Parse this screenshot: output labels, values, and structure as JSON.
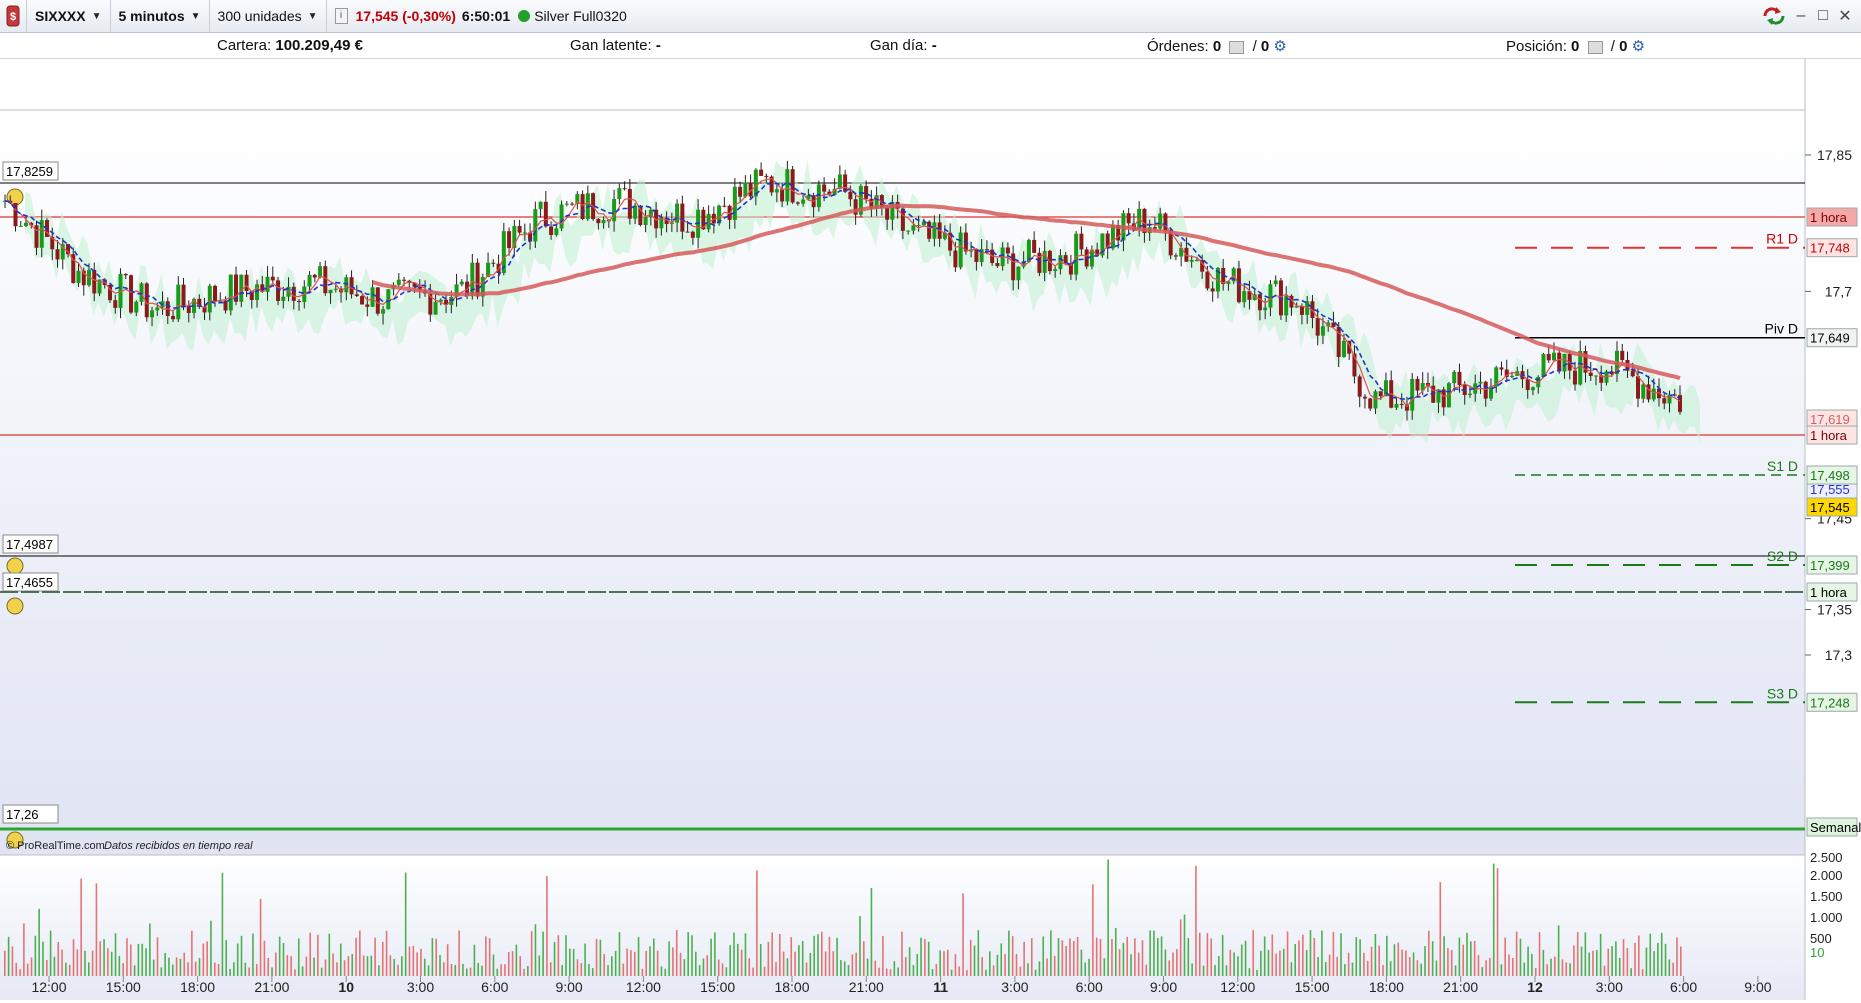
{
  "toolbar": {
    "instrument": "SIXXXX",
    "timeframe": "5 minutos",
    "units": "300 unidades",
    "price_change": "17,545 (-0,30%)",
    "time": "6:50:01",
    "account": "Silver Full0320",
    "info_icon": "info-icon",
    "status_color": "#22a02a"
  },
  "status": {
    "cartera_label": "Cartera:",
    "cartera_value": "100.209,49 €",
    "gan_latente_label": "Gan latente:",
    "gan_latente_value": "-",
    "gan_dia_label": "Gan día:",
    "gan_dia_value": "-",
    "ordenes_label": "Órdenes:",
    "ordenes_a": "0",
    "ordenes_b": "0",
    "posicion_label": "Posición:",
    "posicion_a": "0",
    "posicion_b": "0",
    "slash": "/"
  },
  "chart": {
    "y_ticks": [
      "17,85",
      "17,7",
      "17,45",
      "17,35",
      "17,3"
    ],
    "price_tags": [
      {
        "text": "1 hora",
        "bg": "#f4a8a8",
        "color": "#7a0000"
      },
      {
        "text": "17,748",
        "bg": "#ffe4e4",
        "color": "#c00000"
      },
      {
        "text": "17,649",
        "bg": "#f2f2f2",
        "color": "#000"
      },
      {
        "text": "17,619",
        "bg": "#ffe4e4",
        "color": "#d06060"
      },
      {
        "text": "1 hora",
        "bg": "#ffe4e4",
        "color": "#7a0000"
      },
      {
        "text": "17,555",
        "bg": "#eef0ff",
        "color": "#2233cc"
      },
      {
        "text": "17,545",
        "bg": "#ffd700",
        "color": "#000"
      },
      {
        "text": "17,498",
        "bg": "#e6f5e6",
        "color": "#1a7a1a"
      },
      {
        "text": "1 hora",
        "bg": "#e6f5e6",
        "color": "#000"
      },
      {
        "text": "17,399",
        "bg": "#e6f5e6",
        "color": "#1a7a1a"
      },
      {
        "text": "Semanal",
        "bg": "#dff4df",
        "color": "#000"
      },
      {
        "text": "17,248",
        "bg": "#e6f5e6",
        "color": "#1a7a1a"
      }
    ],
    "level_labels": {
      "r1": "R1 D",
      "piv": "Piv D",
      "s1": "S1 D",
      "s2": "S2 D",
      "s3": "S3 D"
    },
    "left_tags": [
      "17,8259",
      "17,4987",
      "17,4655",
      "17,26"
    ],
    "footer_brand": "© ProRealTime.com",
    "footer_note": "Datos recibidos en tiempo real",
    "volume_ticks": [
      "2.500",
      "2.000",
      "1.500",
      "1.000",
      "500",
      "10"
    ],
    "x_ticks": [
      {
        "label": "12:00",
        "bold": false
      },
      {
        "label": "15:00",
        "bold": false
      },
      {
        "label": "18:00",
        "bold": false
      },
      {
        "label": "21:00",
        "bold": false
      },
      {
        "label": "10",
        "bold": true
      },
      {
        "label": "3:00",
        "bold": false
      },
      {
        "label": "6:00",
        "bold": false
      },
      {
        "label": "9:00",
        "bold": false
      },
      {
        "label": "12:00",
        "bold": false
      },
      {
        "label": "15:00",
        "bold": false
      },
      {
        "label": "18:00",
        "bold": false
      },
      {
        "label": "21:00",
        "bold": false
      },
      {
        "label": "11",
        "bold": true
      },
      {
        "label": "3:00",
        "bold": false
      },
      {
        "label": "6:00",
        "bold": false
      },
      {
        "label": "9:00",
        "bold": false
      },
      {
        "label": "12:00",
        "bold": false
      },
      {
        "label": "15:00",
        "bold": false
      },
      {
        "label": "18:00",
        "bold": false
      },
      {
        "label": "21:00",
        "bold": false
      },
      {
        "label": "12",
        "bold": true
      },
      {
        "label": "3:00",
        "bold": false
      },
      {
        "label": "6:00",
        "bold": false
      },
      {
        "label": "9:00",
        "bold": false
      }
    ]
  },
  "chart_data": {
    "type": "line",
    "title": "",
    "xlabel": "",
    "ylabel": "",
    "x": [
      "12:00",
      "15:00",
      "18:00",
      "21:00",
      "10",
      "3:00",
      "6:00",
      "9:00",
      "12:00",
      "15:00",
      "18:00",
      "21:00",
      "11",
      "3:00",
      "6:00",
      "9:00",
      "12:00",
      "15:00",
      "18:00",
      "21:00",
      "12",
      "3:00",
      "6:00"
    ],
    "series": [
      {
        "values": [
          17.8,
          17.72,
          17.68,
          17.7,
          17.71,
          17.69,
          17.7,
          17.78,
          17.8,
          17.78,
          17.82,
          17.81,
          17.76,
          17.73,
          17.74,
          17.78,
          17.71,
          17.69,
          17.58,
          17.59,
          17.61,
          17.62,
          17.58
        ]
      }
    ],
    "ylim": [
      17.21,
      17.9
    ],
    "levels": {
      "r1_d": 17.748,
      "piv_d": 17.649,
      "s1_d": 17.498,
      "s2_d": 17.399,
      "s3_d": 17.248,
      "last": 17.545
    }
  }
}
